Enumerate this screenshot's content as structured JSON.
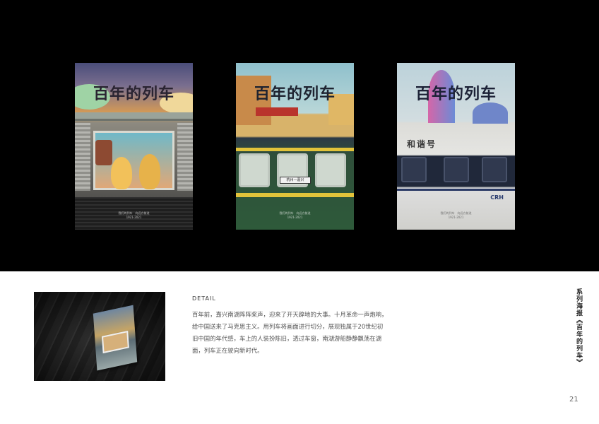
{
  "posters": [
    {
      "title_art": "百年的列车",
      "caption": "我们的列车　向远方前进\n1921-2021"
    },
    {
      "title_art": "百年的列车",
      "sign": "杭州—嘉兴",
      "caption": "我们的列车　向远方前进\n1921-2021"
    },
    {
      "title_art": "百年的列车",
      "nameplate": "和谐号",
      "badge": "CRH",
      "caption": "我们的列车　向远方前进\n1921-2021"
    }
  ],
  "detail": {
    "label": "DETAIL",
    "text": "百年前，嘉兴南湖阵阵桨声，迎来了开天辟地的大事。十月革命一声炮响，给中国送来了马克思主义。用列车将画面进行切分，展现独属于20世纪初旧中国的年代感，车上的人装扮陈旧，透过车窗，南湖游船静静飘荡在湖面，列车正在驶向新时代。"
  },
  "sidebar": {
    "vertical_title": "系列海报《百年的列车》"
  },
  "page": {
    "number": "21"
  },
  "colors": {
    "top_band": "#000000",
    "background": "#ffffff",
    "text": "#555555"
  }
}
